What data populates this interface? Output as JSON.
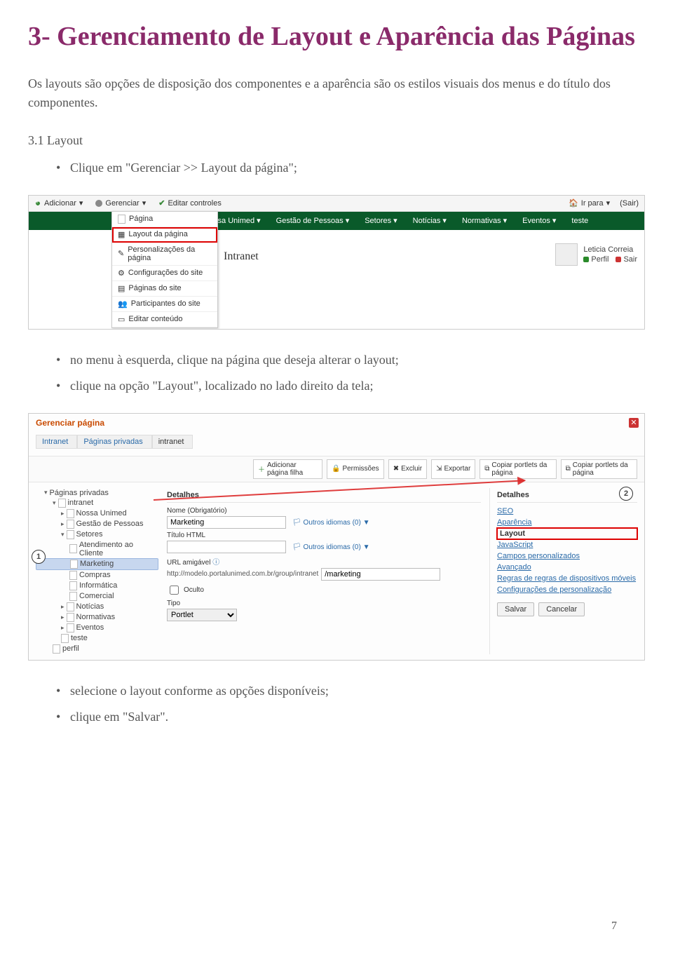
{
  "heading": "3- Gerenciamento de Layout e Aparência das Páginas",
  "intro": "Os layouts são opções de disposição dos componentes  e a aparência são os estilos visuais dos menus e do título dos componentes.",
  "subsection": "3.1 Layout",
  "step1": "Clique em \"Gerenciar >> Layout da página\";",
  "step2": "no menu à esquerda, clique na página que deseja alterar o layout;",
  "step3": "clique na opção \"Layout\", localizado no lado direito da tela;",
  "step4": "selecione o layout conforme as opções disponíveis;",
  "step5": "clique em \"Salvar\".",
  "page_number": "7",
  "adminbar": {
    "add": "Adicionar",
    "manage": "Gerenciar",
    "edit_controls": "Editar controles",
    "goto": "Ir para",
    "signout": "(Sair)"
  },
  "dropdown": {
    "pagina": "Página",
    "layout": "Layout da página",
    "personal": "Personalizações da página",
    "config": "Configurações do site",
    "paginas_site": "Páginas do site",
    "participantes": "Participantes do site",
    "editar_conteudo": "Editar conteúdo"
  },
  "nav": {
    "i1": "Nossa Unimed",
    "i2": "Gestão de Pessoas",
    "i3": "Setores",
    "i4": "Notícias",
    "i5": "Normativas",
    "i6": "Eventos",
    "i7": "teste"
  },
  "user": {
    "name": "Leticia Correia",
    "perfil": "Perfil",
    "sair": "Sair"
  },
  "intranet_title": "Intranet",
  "manage": {
    "title": "Gerenciar página",
    "crumb1": "Intranet",
    "crumb2": "Páginas privadas",
    "crumb3": "intranet",
    "tb_add": "Adicionar página filha",
    "tb_perm": "Permissões",
    "tb_del": "Excluir",
    "tb_exp": "Exportar",
    "tb_copy1": "Copiar portlets da página",
    "tb_copy2": "Copiar portlets da página"
  },
  "tree": {
    "root": "Páginas privadas",
    "intranet": "intranet",
    "nossa": "Nossa Unimed",
    "gestao": "Gestão de Pessoas",
    "setores": "Setores",
    "atend": "Atendimento ao Cliente",
    "marketing": "Marketing",
    "compras": "Compras",
    "info": "Informática",
    "comercial": "Comercial",
    "noticias": "Notícias",
    "normativas": "Normativas",
    "eventos": "Eventos",
    "teste": "teste",
    "perfil": "perfil"
  },
  "form": {
    "detalhes": "Detalhes",
    "nome_label": "Nome (Obrigatório)",
    "nome_value": "Marketing",
    "outros": "Outros idiomas (0)",
    "titulo_html": "Título HTML",
    "url_label": "URL amigável",
    "url_base": "http://modelo.portalunimed.com.br/group/intranet",
    "url_value": "/marketing",
    "oculto": "Oculto",
    "tipo": "Tipo",
    "tipo_value": "Portlet"
  },
  "side": {
    "detalhes": "Detalhes",
    "seo": "SEO",
    "aparencia": "Aparência",
    "layout": "Layout",
    "javascript": "JavaScript",
    "campos": "Campos personalizados",
    "avancado": "Avançado",
    "regras": "Regras de regras de dispositivos móveis",
    "config_pers": "Configurações de personalização",
    "salvar": "Salvar",
    "cancelar": "Cancelar"
  },
  "badges": {
    "one": "1",
    "two": "2"
  }
}
